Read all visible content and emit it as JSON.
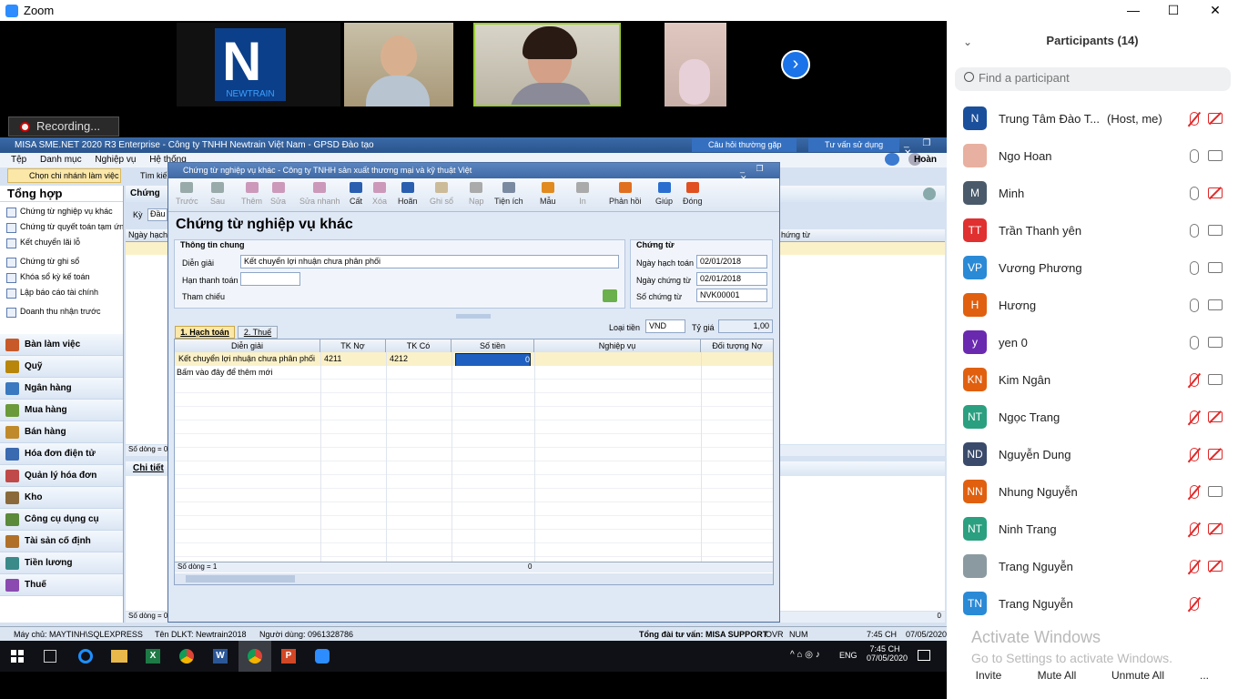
{
  "zoom": {
    "title": "Zoom",
    "min": "—",
    "max": "☐",
    "close": "✕",
    "recording": "Recording...",
    "newtrain_text": "NEWTRAIN"
  },
  "misa": {
    "title": "MISA SME.NET 2020 R3 Enterprise - Công ty TNHH Newtrain Việt Nam - GPSD Đào tạo",
    "faq": "Câu hỏi thường gặp",
    "advice": "Tư vấn sử dụng",
    "user": "Hoàn",
    "menu": [
      "Tệp",
      "Danh mục",
      "Nghiệp vụ",
      "Hệ thống"
    ],
    "branch": "Chọn chi nhánh làm việc",
    "search": "Tìm kiế",
    "left_title": "Tổng hợp",
    "quick_links": [
      "Chứng từ nghiệp vụ khác",
      "Chứng từ quyết toán tạm ứn...",
      "Kết chuyển lãi lỗ",
      "Chứng từ ghi sổ",
      "Khóa sổ kỳ kế toán",
      "Lập báo cáo tài chính",
      "Doanh thu nhận trước"
    ],
    "nav": [
      "Bàn làm việc",
      "Quỹ",
      "Ngân hàng",
      "Mua hàng",
      "Bán hàng",
      "Hóa đơn điện tử",
      "Quản lý hóa đơn",
      "Kho",
      "Công cụ dụng cụ",
      "Tài sản cố định",
      "Tiền lương",
      "Thuế"
    ],
    "bg_labels": {
      "chung": "Chứng",
      "ky": "Kỳ",
      "dau": "Đầu",
      "ngay": "Ngày hạch",
      "sodong": "Số dòng = 0",
      "chitiet": "Chi tiết",
      "sodong2": "Số dòng = 0",
      "zero": "0",
      "chung_tu": "hứng từ"
    },
    "status": {
      "server": "Máy chủ: MAYTINH\\SQLEXPRESS",
      "db": "Tên DLKT: Newtrain2018",
      "userline": "Người dùng: 0961328786",
      "hotline": "Tổng đài tư vấn: MISA SUPPORT",
      "ovr": "OVR",
      "num": "NUM",
      "time": "7:45 CH",
      "date": "07/05/2020"
    }
  },
  "dialog": {
    "title": "Chứng từ nghiệp vụ khác - Công ty TNHH sản xuất thương mại và kỹ thuật Việt",
    "heading": "Chứng từ nghiệp vụ khác",
    "toolbar": [
      {
        "label": "Trước",
        "enabled": false,
        "color": "#9aa"
      },
      {
        "label": "Sau",
        "enabled": false,
        "color": "#9aa"
      },
      {
        "label": "Thêm",
        "enabled": false,
        "color": "#c9b"
      },
      {
        "label": "Sửa",
        "enabled": false,
        "color": "#c9b"
      },
      {
        "label": "Sửa nhanh",
        "enabled": false,
        "color": "#c9b"
      },
      {
        "label": "Cất",
        "enabled": true,
        "color": "#2a5fb0"
      },
      {
        "label": "Xóa",
        "enabled": false,
        "color": "#c9b"
      },
      {
        "label": "Hoãn",
        "enabled": true,
        "color": "#2a5fb0"
      },
      {
        "label": "Ghi sổ",
        "enabled": false,
        "color": "#cb9"
      },
      {
        "label": "Nạp",
        "enabled": false,
        "color": "#aaa"
      },
      {
        "label": "Tiện ích",
        "enabled": true,
        "color": "#7a8aa0"
      },
      {
        "label": "Mẫu",
        "enabled": true,
        "color": "#e08a20"
      },
      {
        "label": "In",
        "enabled": false,
        "color": "#aaa"
      },
      {
        "label": "Phản hồi",
        "enabled": true,
        "color": "#e07020"
      },
      {
        "label": "Giúp",
        "enabled": true,
        "color": "#2a6fd0"
      },
      {
        "label": "Đóng",
        "enabled": true,
        "color": "#e05020"
      }
    ],
    "general": {
      "group": "Thông tin chung",
      "desc_label": "Diễn giải",
      "desc_value": "Kết chuyển lợi nhuận chưa phân phối",
      "due_label": "Hạn thanh toán",
      "due_value": "",
      "ref_label": "Tham chiếu"
    },
    "voucher": {
      "group": "Chứng từ",
      "post_date_label": "Ngày hạch toán",
      "post_date": "02/01/2018",
      "doc_date_label": "Ngày chứng từ",
      "doc_date": "02/01/2018",
      "no_label": "Số chứng từ",
      "no": "NVK00001"
    },
    "tabs": [
      "1. Hạch toán",
      "2. Thuế"
    ],
    "currency_label": "Loại tiền",
    "currency": "VND",
    "rate_label": "Tỷ giá",
    "rate": "1,00",
    "columns": [
      "Diễn giải",
      "TK Nợ",
      "TK Có",
      "Số tiền",
      "Nghiệp vụ",
      "Đối tượng Nợ"
    ],
    "rows": [
      [
        "Kết chuyển lợi nhuận chưa phân phối",
        "4211",
        "4212",
        "0",
        "",
        ""
      ]
    ],
    "add_hint": "Bấm vào đây để thêm mới",
    "footer_count": "Số dòng = 1",
    "footer_sum": "0"
  },
  "taskbar": {
    "lang": "ENG",
    "time": "7:45 CH",
    "date": "07/05/2020"
  },
  "participants": {
    "title": "Participants (14)",
    "search_placeholder": "Find a participant",
    "list": [
      {
        "name": "Trung Tâm Đào T...",
        "suffix": "(Host, me)",
        "initials": "N",
        "color": "#1a4f9c",
        "mic_off": true,
        "cam_off": true
      },
      {
        "name": "Ngo Hoan",
        "suffix": "",
        "initials": "",
        "color": "#e8b0a0",
        "mic_off": false,
        "cam_off": false
      },
      {
        "name": "Minh",
        "suffix": "",
        "initials": "M",
        "color": "#4a5a6a",
        "mic_off": false,
        "cam_off": true
      },
      {
        "name": "Trần Thanh yên",
        "suffix": "",
        "initials": "TT",
        "color": "#e03030",
        "mic_off": false,
        "cam_off": false
      },
      {
        "name": "Vương Phương",
        "suffix": "",
        "initials": "VP",
        "color": "#2a8ad6",
        "mic_off": false,
        "cam_off": false
      },
      {
        "name": "Hương",
        "suffix": "",
        "initials": "H",
        "color": "#e06010",
        "mic_off": false,
        "cam_off": false
      },
      {
        "name": "yen 0",
        "suffix": "",
        "initials": "y",
        "color": "#6a2ab0",
        "mic_off": false,
        "cam_off": false
      },
      {
        "name": "Kim Ngân",
        "suffix": "",
        "initials": "KN",
        "color": "#e06010",
        "mic_off": true,
        "cam_off": false
      },
      {
        "name": "Ngọc Trang",
        "suffix": "",
        "initials": "NT",
        "color": "#2aa080",
        "mic_off": true,
        "cam_off": true
      },
      {
        "name": "Nguyễn Dung",
        "suffix": "",
        "initials": "ND",
        "color": "#3a4a6a",
        "mic_off": true,
        "cam_off": true
      },
      {
        "name": "Nhung Nguyễn",
        "suffix": "",
        "initials": "NN",
        "color": "#e06010",
        "mic_off": true,
        "cam_off": false
      },
      {
        "name": "Ninh Trang",
        "suffix": "",
        "initials": "NT",
        "color": "#2aa080",
        "mic_off": true,
        "cam_off": true
      },
      {
        "name": "Trang Nguyễn",
        "suffix": "",
        "initials": "",
        "color": "#8a9aa0",
        "mic_off": true,
        "cam_off": true
      },
      {
        "name": "Trang Nguyễn",
        "suffix": "",
        "initials": "TN",
        "color": "#2a8ad6",
        "mic_off": true,
        "cam_off": null
      }
    ],
    "watermark1": "Activate Windows",
    "watermark2": "Go to Settings to activate Windows.",
    "invite": "Invite",
    "mute_all": "Mute All",
    "unmute_all": "Unmute All",
    "more": "..."
  }
}
